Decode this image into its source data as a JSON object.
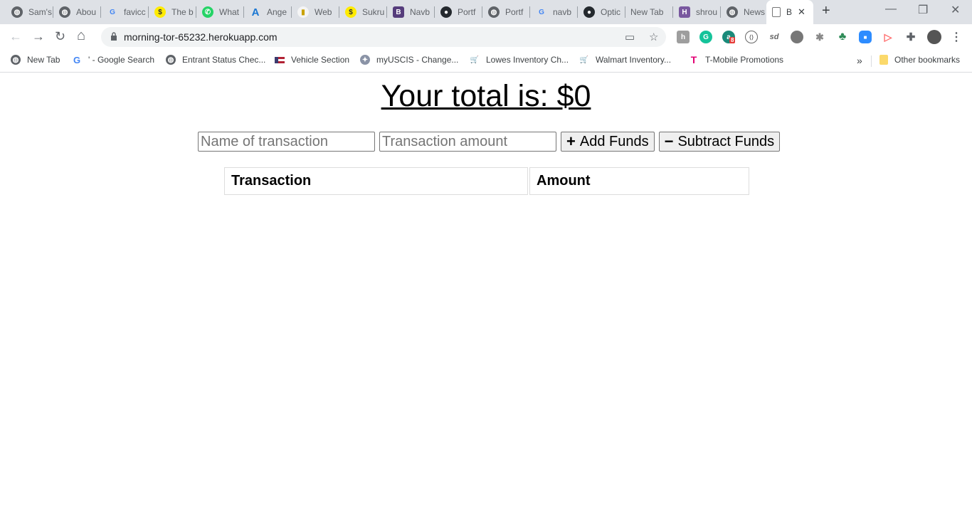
{
  "browser": {
    "tabs": [
      {
        "title": "Sam's",
        "icon": "globe-icon"
      },
      {
        "title": "Abou",
        "icon": "globe-icon"
      },
      {
        "title": "favicc",
        "icon": "google-icon"
      },
      {
        "title": "The b",
        "icon": "sukru-icon"
      },
      {
        "title": "What",
        "icon": "whatsapp-icon"
      },
      {
        "title": "Ange",
        "icon": "angular-icon"
      },
      {
        "title": "Web",
        "icon": "web-icon"
      },
      {
        "title": "Sukru",
        "icon": "sukru-icon"
      },
      {
        "title": "Navb",
        "icon": "bootstrap-icon"
      },
      {
        "title": "Portf",
        "icon": "github-icon"
      },
      {
        "title": "Portf",
        "icon": "globe-icon"
      },
      {
        "title": "navb",
        "icon": "google-icon"
      },
      {
        "title": "Optic",
        "icon": "github-icon"
      },
      {
        "title": "New Tab",
        "icon": ""
      },
      {
        "title": "shrou",
        "icon": "heroku-icon"
      },
      {
        "title": "News",
        "icon": "globe-icon"
      },
      {
        "title": "B",
        "icon": "document-icon",
        "active": true
      }
    ],
    "new_tab_symbol": "+",
    "window_controls": {
      "minimize": "—",
      "restore": "❐",
      "close": "✕"
    },
    "nav": {
      "back": "←",
      "forward": "→",
      "reload": "↻",
      "home": "⌂"
    },
    "url": "morning-tor-65232.herokuapp.com",
    "extensions": [
      {
        "name": "honey-extension-icon",
        "label": "h",
        "color": "#9e9e9e"
      },
      {
        "name": "grammarly-extension-icon",
        "label": "G",
        "color": "#15c39a"
      },
      {
        "name": "a-extension-icon",
        "label": "a",
        "color": "#1a8a7a",
        "badge": "8"
      },
      {
        "name": "code-extension-icon",
        "label": "⟨⟩",
        "color": "#777"
      },
      {
        "name": "sd-extension-icon",
        "label": "sd",
        "color": "#777"
      },
      {
        "name": "sphere-extension-icon",
        "label": "●",
        "color": "#666"
      },
      {
        "name": "bug-extension-icon",
        "label": "✱",
        "color": "#888"
      },
      {
        "name": "html-tree-extension-icon",
        "label": "♣",
        "color": "#2e8b57"
      },
      {
        "name": "zoom-extension-icon",
        "label": "▶",
        "color": "#2d8cff"
      },
      {
        "name": "red-arrow-extension-icon",
        "label": "▷",
        "color": "#ff6b6b"
      },
      {
        "name": "puzzle-extensions-icon",
        "label": "✚",
        "color": "#5f6368"
      },
      {
        "name": "profile-avatar",
        "label": "",
        "color": "#555"
      }
    ],
    "bookmarks": [
      {
        "label": "New Tab",
        "icon": "globe-icon"
      },
      {
        "label": "' - Google Search",
        "icon": "google-icon"
      },
      {
        "label": "Entrant Status Chec...",
        "icon": "globe-icon"
      },
      {
        "label": "Vehicle Section",
        "icon": "flag-icon"
      },
      {
        "label": "myUSCIS - Change...",
        "icon": "dhs-seal-icon"
      },
      {
        "label": "Lowes Inventory Ch...",
        "icon": "cart-icon"
      },
      {
        "label": "Walmart Inventory...",
        "icon": "cart-icon"
      },
      {
        "label": "T-Mobile Promotions",
        "icon": "tmobile-icon"
      }
    ],
    "bookmarks_overflow": "»",
    "other_bookmarks": "Other bookmarks"
  },
  "app": {
    "total_label": "Your total is: $0",
    "name_placeholder": "Name of transaction",
    "amount_placeholder": "Transaction amount",
    "add_label": "Add Funds",
    "add_symbol": "+",
    "subtract_label": "Subtract Funds",
    "subtract_symbol": "−",
    "table": {
      "headers": [
        "Transaction",
        "Amount"
      ],
      "rows": []
    }
  }
}
